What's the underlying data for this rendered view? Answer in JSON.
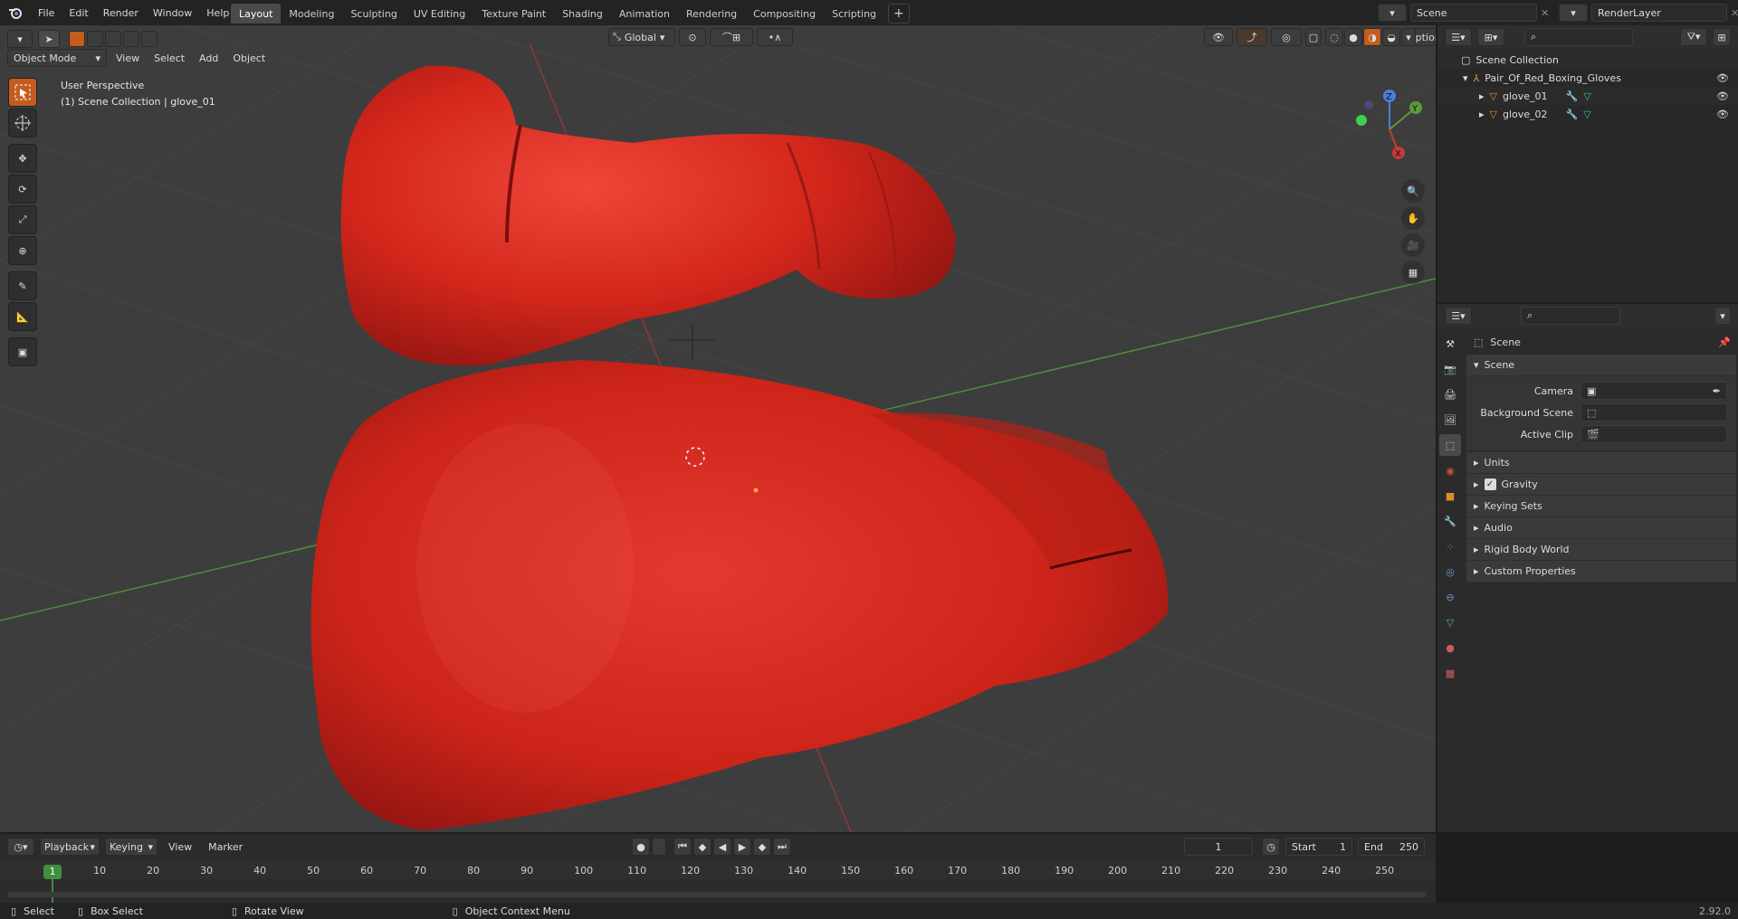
{
  "app": {
    "version": "2.92.0"
  },
  "menu": [
    "File",
    "Edit",
    "Render",
    "Window",
    "Help"
  ],
  "workspaces": [
    "Layout",
    "Modeling",
    "Sculpting",
    "UV Editing",
    "Texture Paint",
    "Shading",
    "Animation",
    "Rendering",
    "Compositing",
    "Scripting"
  ],
  "active_workspace": "Layout",
  "scene_field": "Scene",
  "layer_field": "RenderLayer",
  "viewport": {
    "mode": "Object Mode",
    "menus": [
      "View",
      "Select",
      "Add",
      "Object"
    ],
    "orientation": "Global",
    "options_label": "Options",
    "overlay_title": "User Perspective",
    "overlay_sub": "(1) Scene Collection | glove_01",
    "gizmo": {
      "x": "X",
      "y": "Y",
      "z": "Z"
    }
  },
  "outliner": {
    "root": "Scene Collection",
    "collection": "Pair_Of_Red_Boxing_Gloves",
    "objects": [
      "glove_01",
      "glove_02"
    ]
  },
  "properties": {
    "header": "Scene",
    "panel": "Scene",
    "fields": [
      {
        "label": "Camera"
      },
      {
        "label": "Background Scene"
      },
      {
        "label": "Active Clip"
      }
    ],
    "subpanels": [
      "Units",
      "Gravity",
      "Keying Sets",
      "Audio",
      "Rigid Body World",
      "Custom Properties"
    ],
    "gravity_checked": true
  },
  "timeline": {
    "menus": [
      "Playback",
      "Keying",
      "View",
      "Marker"
    ],
    "current_frame": "1",
    "start_label": "Start",
    "start": "1",
    "end_label": "End",
    "end": "250",
    "ticks": [
      "1",
      "10",
      "20",
      "30",
      "40",
      "50",
      "60",
      "70",
      "80",
      "90",
      "100",
      "110",
      "120",
      "130",
      "140",
      "150",
      "160",
      "170",
      "180",
      "190",
      "200",
      "210",
      "220",
      "230",
      "240",
      "250"
    ]
  },
  "statusbar": {
    "select": "Select",
    "box_select": "Box Select",
    "rotate_view": "Rotate View",
    "context_menu": "Object Context Menu"
  },
  "colors": {
    "accent": "#4772b3",
    "active_tool": "#c45c1e",
    "glove": "#d7261b",
    "x_axis": "#8c3a3a",
    "y_axis": "#4f8f3a"
  }
}
